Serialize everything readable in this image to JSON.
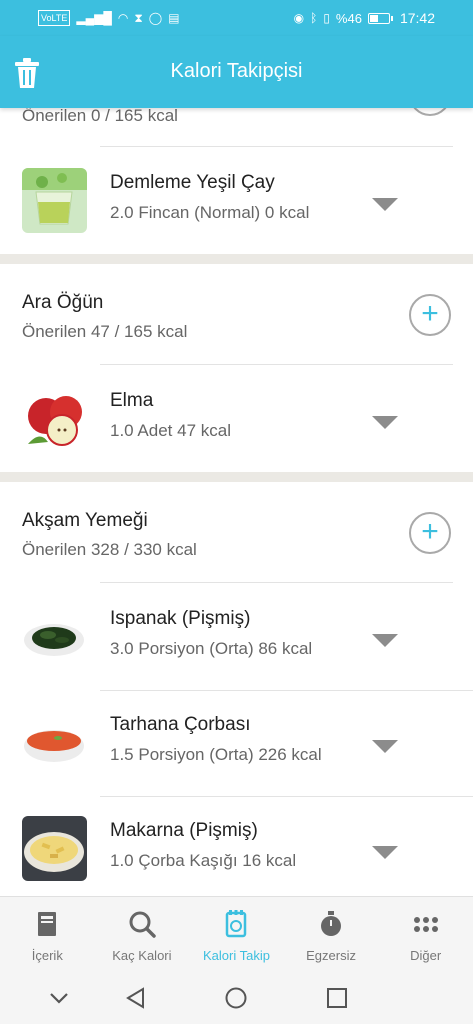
{
  "status_bar": {
    "left_icons": [
      "volte-icon",
      "signal-icon",
      "wifi-icon",
      "hourglass-icon",
      "whatsapp-icon",
      "news-icon"
    ],
    "battery_text": "%46",
    "battery_level": 0.46,
    "time": "17:42"
  },
  "app_bar": {
    "title": "Kalori Takipçisi",
    "left_icon": "trash-icon"
  },
  "sections": {
    "top_partial": {
      "subtitle": "Önerilen 0 / 165 kcal",
      "items": [
        {
          "name": "Demleme Yeşil Çay",
          "detail": "2.0 Fincan (Normal) 0 kcal",
          "thumb": "green-tea"
        }
      ]
    },
    "ara_ogun": {
      "title": "Ara Öğün",
      "subtitle": "Önerilen 47 / 165 kcal",
      "add_label": "+",
      "items": [
        {
          "name": "Elma",
          "detail": "1.0 Adet 47 kcal",
          "thumb": "apple"
        }
      ]
    },
    "aksam_yemegi": {
      "title": "Akşam Yemeği",
      "subtitle": "Önerilen 328 / 330 kcal",
      "add_label": "+",
      "items": [
        {
          "name": "Ispanak (Pişmiş)",
          "detail": "3.0 Porsiyon (Orta) 86 kcal",
          "thumb": "spinach"
        },
        {
          "name": "Tarhana Çorbası",
          "detail": "1.5 Porsiyon (Orta) 226 kcal",
          "thumb": "soup"
        },
        {
          "name": "Makarna (Pişmiş)",
          "detail": "1.0 Çorba Kaşığı 16 kcal",
          "thumb": "pasta"
        }
      ]
    }
  },
  "bottom_nav": [
    {
      "label": "İçerik",
      "icon": "book-icon",
      "active": false
    },
    {
      "label": "Kaç Kalori",
      "icon": "search-icon",
      "active": false
    },
    {
      "label": "Kalori Takip",
      "icon": "tracker-icon",
      "active": true
    },
    {
      "label": "Egzersiz",
      "icon": "stopwatch-icon",
      "active": false
    },
    {
      "label": "Diğer",
      "icon": "more-dots-icon",
      "active": false
    }
  ],
  "system_nav": [
    "chevron-down-icon",
    "back-icon",
    "home-icon",
    "recents-icon"
  ],
  "colors": {
    "accent": "#3cbfdf",
    "separator": "#ebe9e4",
    "muted_text": "#666666"
  }
}
